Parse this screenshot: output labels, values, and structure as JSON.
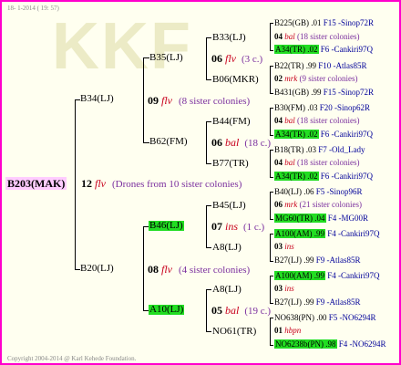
{
  "date": "18- 1-2014 ( 19: 57)",
  "copyright": "Copyright 2004-2014 @ Karl Kehede Foundation.",
  "root": {
    "label": "B203(MAK)",
    "year": "12",
    "code": "flv",
    "note": "(Drones from 10 sister colonies)"
  },
  "gen1": [
    {
      "label": "B34(LJ)",
      "year": "09",
      "code": "flv",
      "note": "(8 sister colonies)"
    },
    {
      "label": "B20(LJ)",
      "year": "08",
      "code": "flv",
      "note": "(4 sister colonies)"
    }
  ],
  "gen2": [
    {
      "label": "B35(LJ)",
      "year": "06",
      "code": "flv",
      "note": "(3 c.)"
    },
    {
      "label": "B62(FM)",
      "year": "06",
      "code": "bal",
      "note": "(18 c.)"
    },
    {
      "label": "B46(LJ)",
      "year": "07",
      "code": "ins",
      "note": "(1 c.)"
    },
    {
      "label": "A10(LJ)",
      "year": "05",
      "code": "bal",
      "note": "(19 c.)"
    }
  ],
  "gen3": [
    {
      "label": "B33(LJ)"
    },
    {
      "label": "B06(MKR)"
    },
    {
      "label": "B44(FM)"
    },
    {
      "label": "B77(TR)"
    },
    {
      "label": "B45(LJ)"
    },
    {
      "label": "A8(LJ)"
    },
    {
      "label": "A8(LJ)"
    },
    {
      "label": "NO61(TR)"
    }
  ],
  "gen4": [
    {
      "a": "B225(GB) .01",
      "a2": "F15 -Sinop72R"
    },
    {
      "yr": "04",
      "code": "bal",
      "note": "(18 sister colonies)"
    },
    {
      "a": "A34(TR) .02",
      "a2": "F6 -Cankiri97Q"
    },
    {
      "a": "B22(TR) .99",
      "a2": "F10 -Atlas85R"
    },
    {
      "yr": "02",
      "code": "mrk",
      "note": "(9 sister colonies)"
    },
    {
      "a": "B431(GB) .99",
      "a2": "F15 -Sinop72R"
    },
    {
      "a": "B30(FM) .03",
      "a2": "F20 -Sinop62R"
    },
    {
      "yr": "04",
      "code": "bal",
      "note": "(18 sister colonies)"
    },
    {
      "a": "A34(TR) .02",
      "a2": "F6 -Cankiri97Q"
    },
    {
      "a": "B18(TR) .03",
      "a2": "F7 -Old_Lady"
    },
    {
      "yr": "04",
      "code": "bal",
      "note": "(18 sister colonies)"
    },
    {
      "a": "A34(TR) .02",
      "a2": "F6 -Cankiri97Q"
    },
    {
      "a": "B40(LJ) .06",
      "a2": "F5 -Sinop96R"
    },
    {
      "yr": "06",
      "code": "mrk",
      "note": "(21 sister colonies)"
    },
    {
      "a": "MG60(TR) .04",
      "a2": "F4 -MG00R"
    },
    {
      "a": "A100(AM) .99",
      "a2": "F4 -Cankiri97Q"
    },
    {
      "yr": "03",
      "code": "ins",
      "note": ""
    },
    {
      "a": "B27(LJ) .99",
      "a2": "F9 -Atlas85R"
    },
    {
      "a": "A100(AM) .99",
      "a2": "F4 -Cankiri97Q"
    },
    {
      "yr": "03",
      "code": "ins",
      "note": ""
    },
    {
      "a": "B27(LJ) .99",
      "a2": "F9 -Atlas85R"
    },
    {
      "a": "NO638(PN) .00",
      "a2": "F5 -NO6294R"
    },
    {
      "yr": "01",
      "code": "hbpn",
      "note": ""
    },
    {
      "a": "NO6238b(PN) .98",
      "a2": "F4 -NO6294R"
    }
  ]
}
